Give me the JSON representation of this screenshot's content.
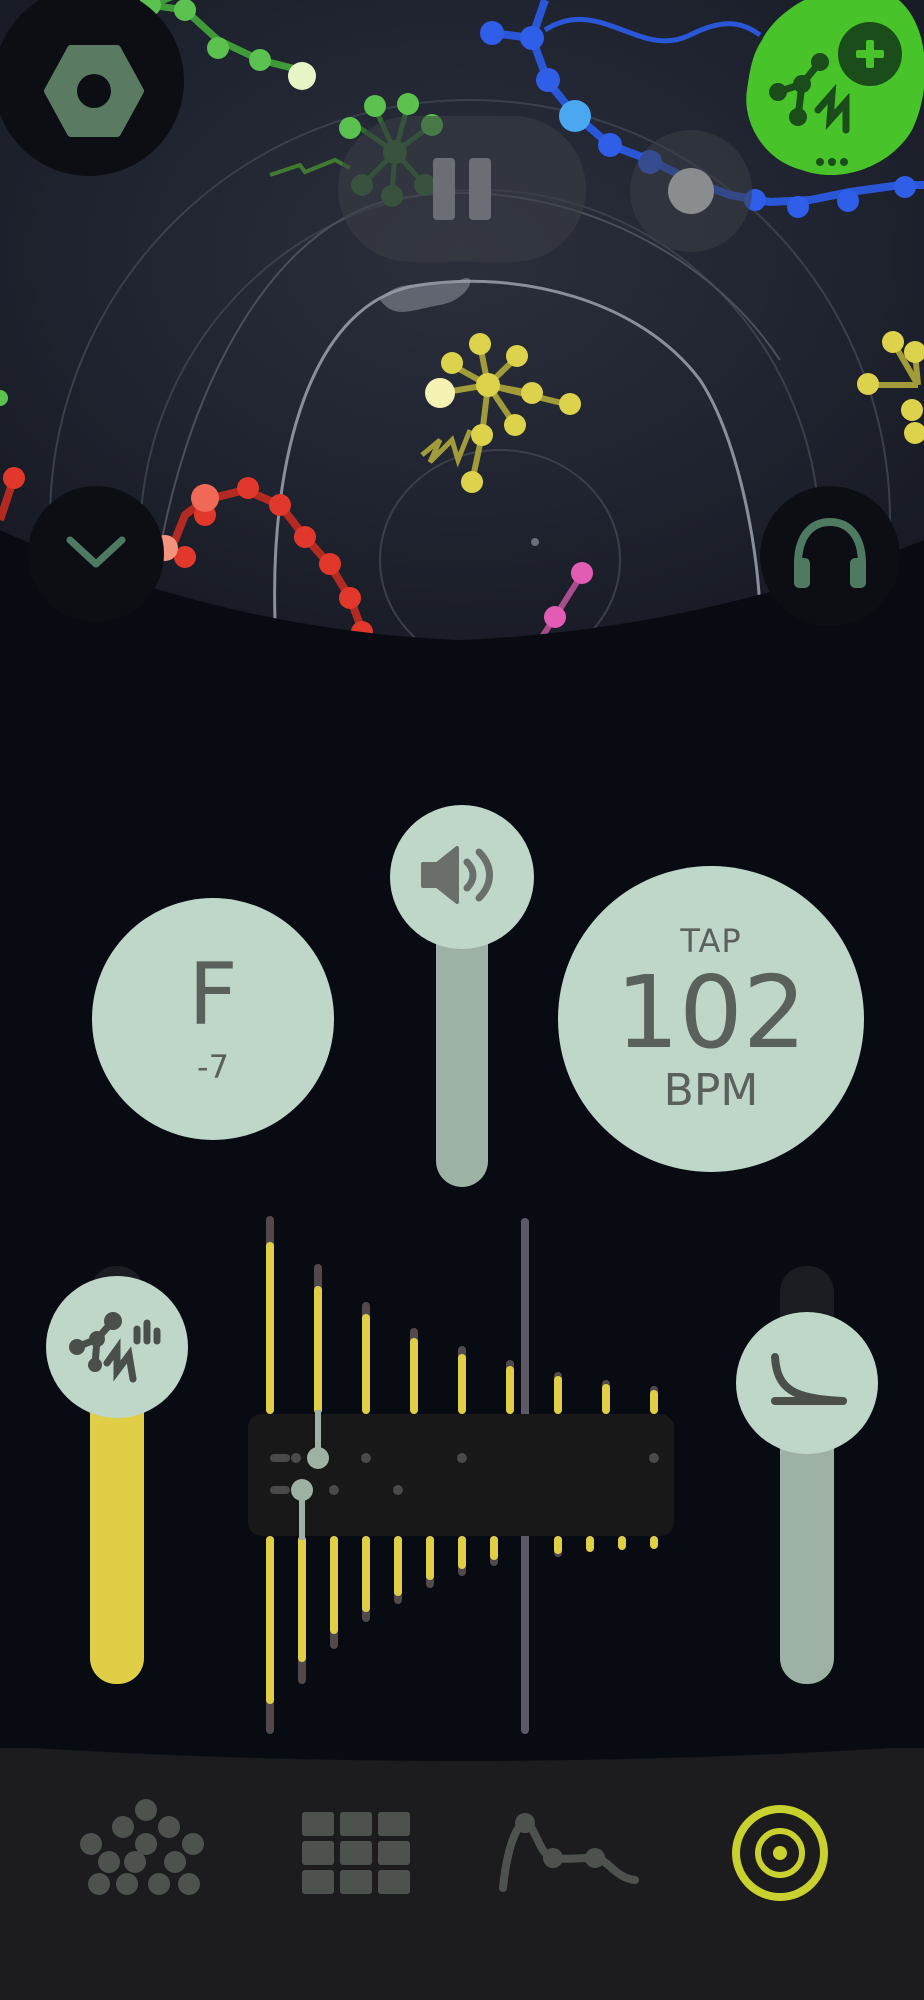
{
  "controls": {
    "settings_icon": "hexagon-nut-icon",
    "add_creature_icon": "plus-molecule-icon",
    "pause_icon": "pause-icon",
    "record_icon": "record-dot-icon",
    "collapse_icon": "chevron-down-icon",
    "headphones_icon": "headphones-icon"
  },
  "key": {
    "note": "F",
    "offset": "-7"
  },
  "tempo": {
    "tap_label": "TAP",
    "value": "102",
    "unit": "BPM"
  },
  "volume": {
    "icon": "speaker-icon",
    "level": 0.75
  },
  "creature_slider": {
    "icon": "creature-molecule-icon",
    "level": 0.72,
    "color": "#e0ce47"
  },
  "decay_slider": {
    "icon": "decay-curve-icon",
    "level": 0.8
  },
  "tabs": [
    {
      "name": "creatures",
      "icon": "dots-cluster-icon",
      "active": false
    },
    {
      "name": "grid",
      "icon": "grid-icon",
      "active": false
    },
    {
      "name": "curve",
      "icon": "curve-nodes-icon",
      "active": false
    },
    {
      "name": "target",
      "icon": "target-icon",
      "active": true
    }
  ],
  "colors": {
    "background": "#090b12",
    "knob": "#bfd7c9",
    "accent_green": "#48c42a",
    "accent_yellow": "#e0ce47",
    "active_tab": "#c9d12e",
    "tab_bar": "#1c1c1f"
  }
}
